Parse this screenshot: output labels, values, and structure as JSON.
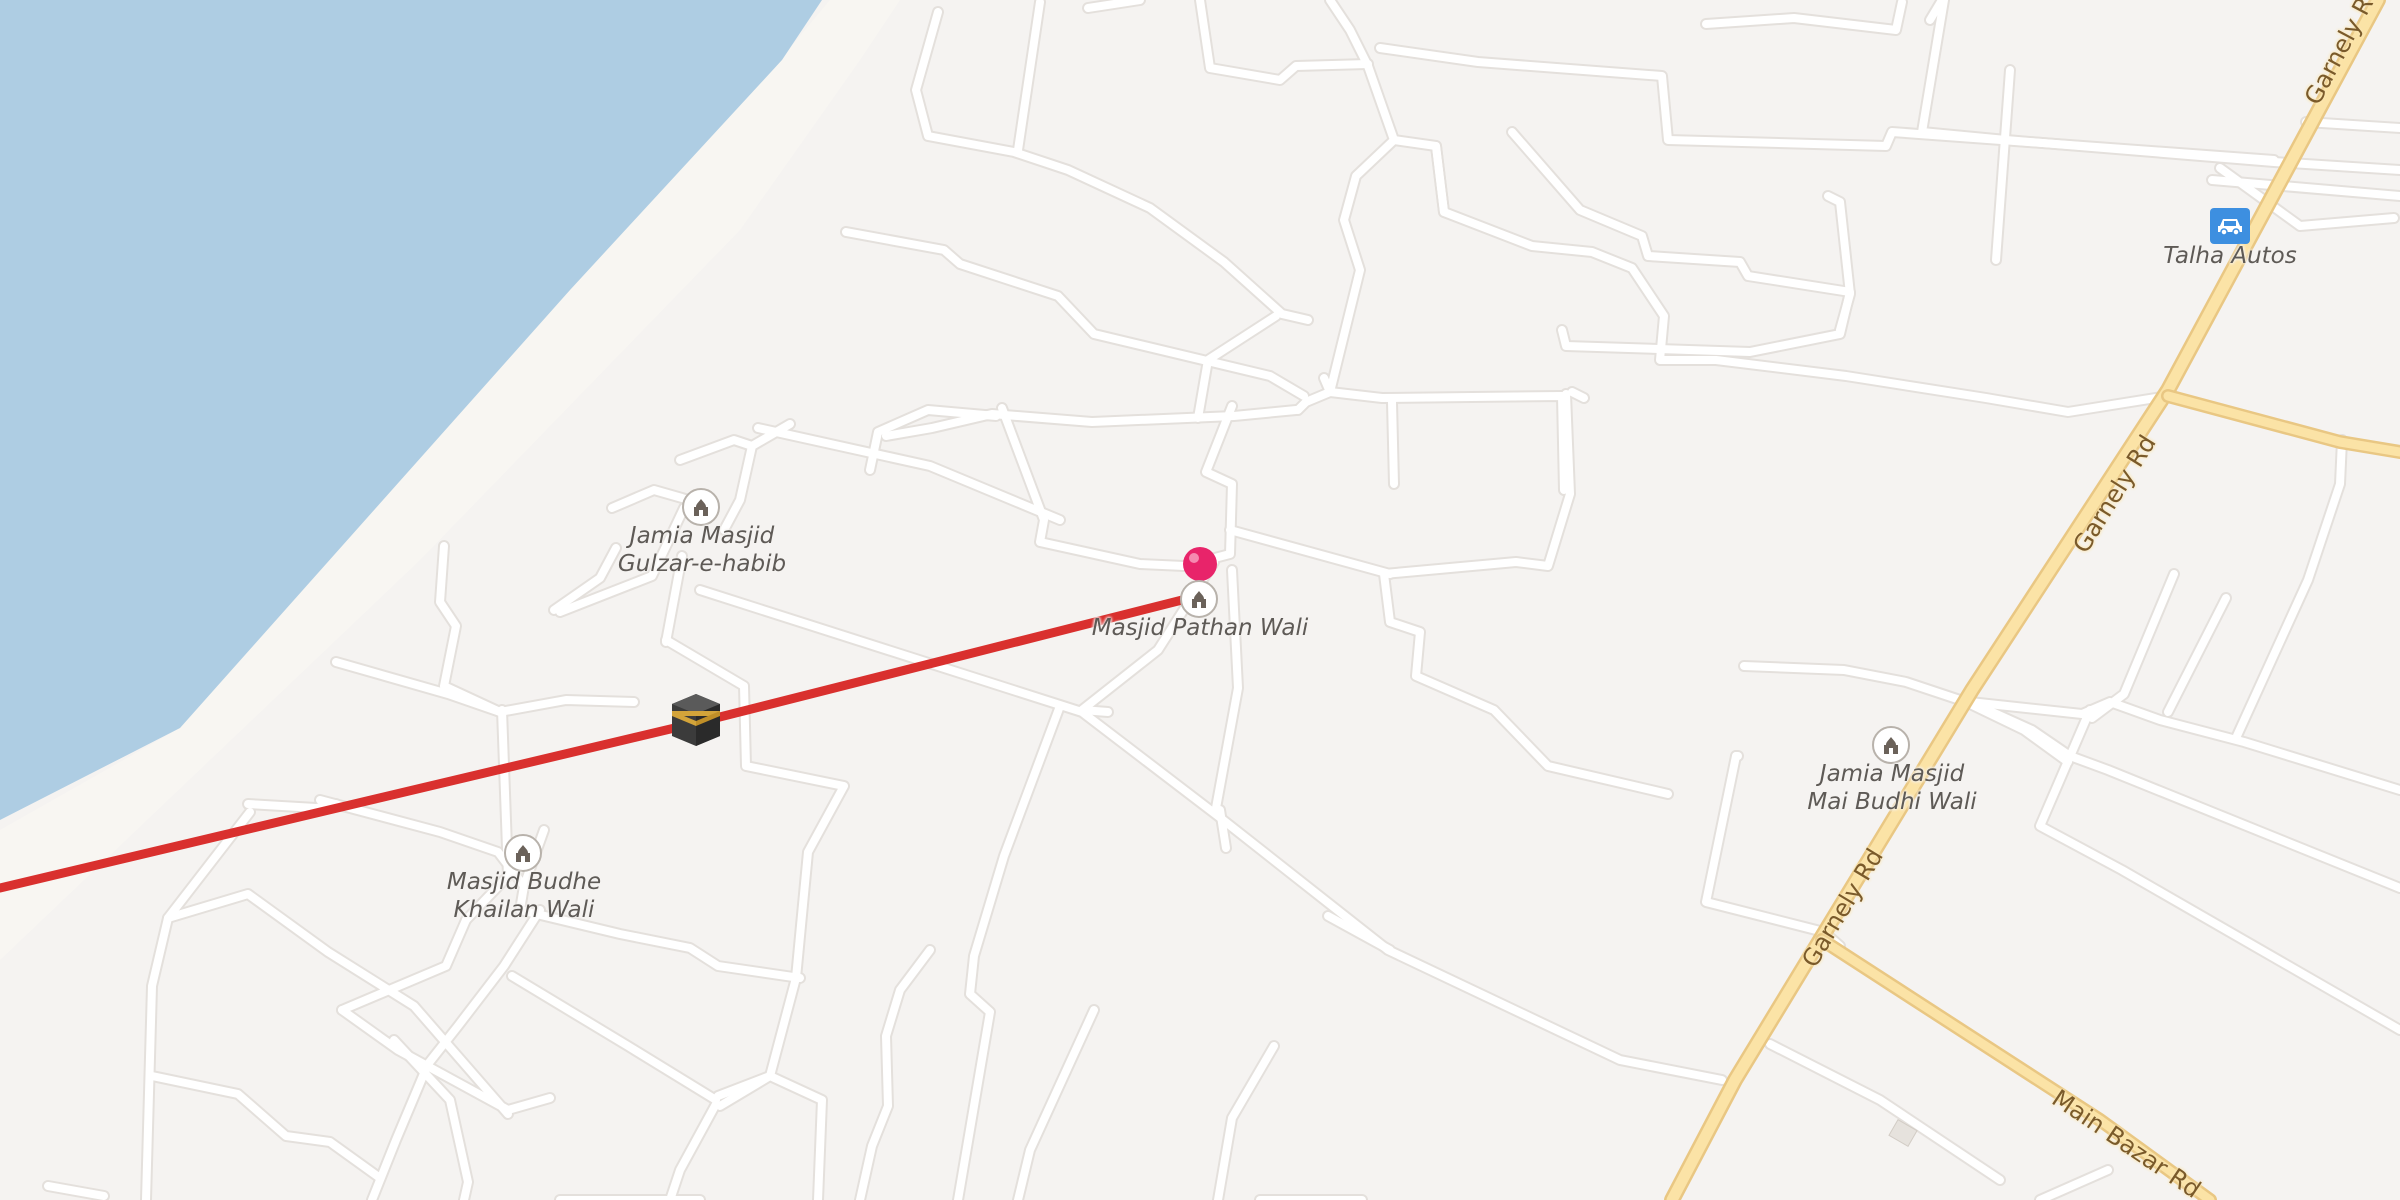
{
  "colors": {
    "water": "#aecde3",
    "land": "#f5f3f1",
    "shore": "#f8f6f2",
    "minor_road": "#ffffff",
    "major_road_fill": "#fbe3a6",
    "major_road_edge": "#e9c783",
    "route_line": "#d9302e",
    "pin": "#e8246a",
    "car_badge": "#3d8fe0"
  },
  "places": {
    "jamia_gulzar": {
      "label_line1": "Jamia Masjid",
      "label_line2": "Gulzar-e-habib",
      "icon": "mosque-icon"
    },
    "pathan_wali": {
      "label": "Masjid Pathan Wali",
      "icon": "mosque-icon"
    },
    "budhe_khailan": {
      "label_line1": "Masjid Budhe",
      "label_line2": "Khailan Wali",
      "icon": "mosque-icon"
    },
    "mai_budhi": {
      "label_line1": "Jamia Masjid",
      "label_line2": "Mai Budhi Wali",
      "icon": "mosque-icon"
    },
    "talha_autos": {
      "label": "Talha Autos",
      "icon": "car-icon"
    }
  },
  "roads": {
    "garnely_top": "Garnely Rd",
    "garnely_mid": "Garnely Rd",
    "garnely_low": "Garnely Rd",
    "main_bazar": "Main Bazar Rd"
  },
  "markers": {
    "destination_pin": "map-pin-icon",
    "kaaba": "kaaba-icon"
  },
  "route": {
    "description_visible": false
  }
}
